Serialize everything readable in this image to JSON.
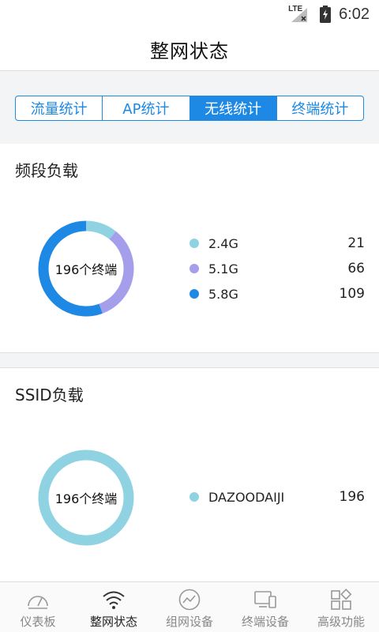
{
  "status_bar": {
    "network": "LTE",
    "time": "6:02"
  },
  "header": {
    "title": "整网状态"
  },
  "tabs": [
    {
      "label": "流量统计",
      "active": false
    },
    {
      "label": "AP统计",
      "active": false
    },
    {
      "label": "无线统计",
      "active": true
    },
    {
      "label": "终端统计",
      "active": false
    }
  ],
  "band_load": {
    "title": "频段负载",
    "center_label": "196个终端",
    "items": [
      {
        "name": "2.4G",
        "value": "21",
        "color": "#8fd3e3"
      },
      {
        "name": "5.1G",
        "value": "66",
        "color": "#a59eea"
      },
      {
        "name": "5.8G",
        "value": "109",
        "color": "#1e88e5"
      }
    ]
  },
  "ssid_load": {
    "title": "SSID负载",
    "center_label": "196个终端",
    "items": [
      {
        "name": "DAZOODAIJI",
        "value": "196",
        "color": "#8fd3e3"
      }
    ]
  },
  "bottom_nav": [
    {
      "label": "仪表板",
      "icon": "gauge-icon",
      "active": false
    },
    {
      "label": "整网状态",
      "icon": "wifi-icon",
      "active": true
    },
    {
      "label": "组网设备",
      "icon": "network-chart-icon",
      "active": false
    },
    {
      "label": "终端设备",
      "icon": "devices-icon",
      "active": false
    },
    {
      "label": "高级功能",
      "icon": "grid-apps-icon",
      "active": false
    }
  ],
  "colors": {
    "accent": "#1e88e5",
    "background": "#f3f4f6"
  }
}
